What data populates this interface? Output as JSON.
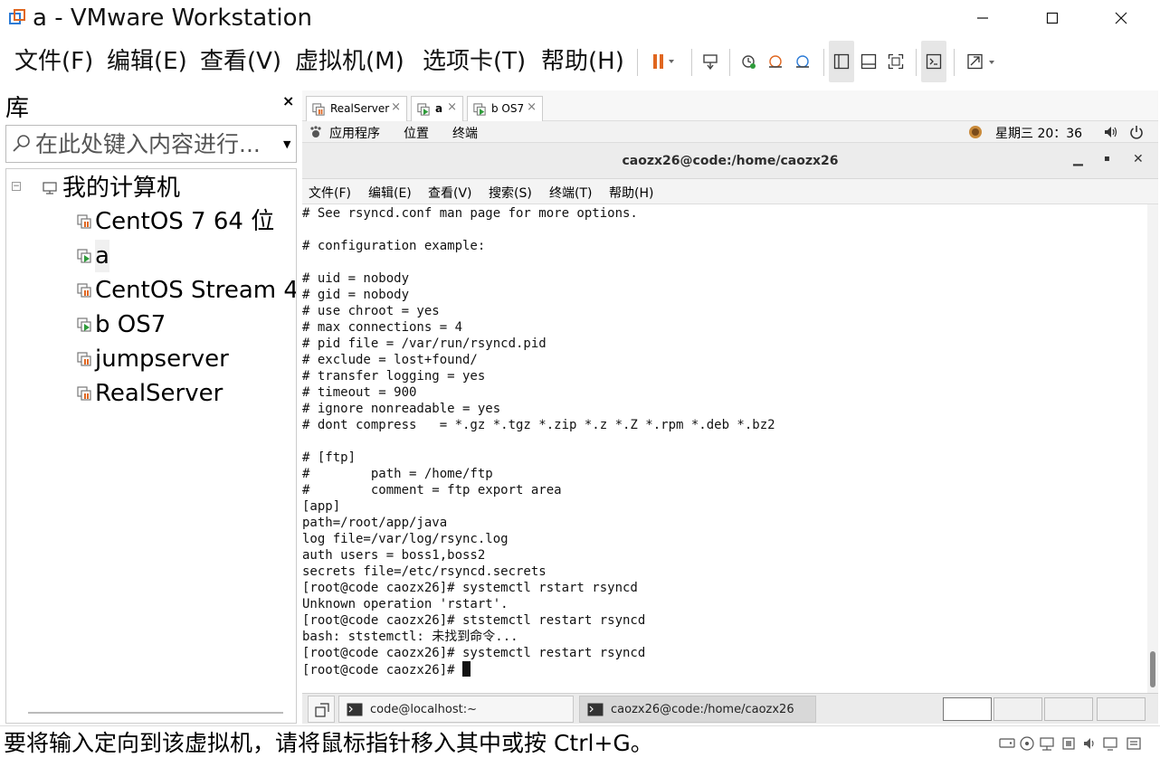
{
  "window": {
    "title": "a - VMware Workstation",
    "minimize": "—",
    "maximize": "☐",
    "close": "✕"
  },
  "menu": {
    "items": [
      "文件(F)",
      "编辑(E)",
      "查看(V)",
      "虚拟机(M)",
      "选项卡(T)",
      "帮助(H)"
    ]
  },
  "colors": {
    "pause": "#e0661f",
    "accent": "#2b7bd6",
    "vm_icon_orange": "#e0661f",
    "vm_running_green": "#2e9b3a"
  },
  "library": {
    "title": "库",
    "close": "×",
    "search_placeholder": "在此处键入内容进行...",
    "root_label": "我的计算机",
    "vms": [
      {
        "label": "CentOS 7 64 位",
        "state": "off"
      },
      {
        "label": "a",
        "state": "running"
      },
      {
        "label": "CentOS Stream 4",
        "state": "off"
      },
      {
        "label": "b OS7",
        "state": "running"
      },
      {
        "label": "jumpserver",
        "state": "off"
      },
      {
        "label": "RealServer",
        "state": "off"
      }
    ]
  },
  "tabs": [
    {
      "label": "RealServer",
      "close": "×",
      "active": false
    },
    {
      "label": "a",
      "close": "×",
      "active": true
    },
    {
      "label": "b OS7",
      "close": "×",
      "active": false
    }
  ],
  "guest": {
    "topbar": {
      "apps": "应用程序",
      "places": "位置",
      "terminal": "终端",
      "clock": "星期三 20：36"
    },
    "terminal_window": {
      "title": "caozx26@code:/home/caozx26",
      "min": "▁",
      "max": "▪",
      "close": "✕",
      "menu": [
        "文件(F)",
        "编辑(E)",
        "查看(V)",
        "搜索(S)",
        "终端(T)",
        "帮助(H)"
      ]
    },
    "lines": [
      "# See rsyncd.conf man page for more options.",
      "",
      "# configuration example:",
      "",
      "# uid = nobody",
      "# gid = nobody",
      "# use chroot = yes",
      "# max connections = 4",
      "# pid file = /var/run/rsyncd.pid",
      "# exclude = lost+found/",
      "# transfer logging = yes",
      "# timeout = 900",
      "# ignore nonreadable = yes",
      "# dont compress   = *.gz *.tgz *.zip *.z *.Z *.rpm *.deb *.bz2",
      "",
      "# [ftp]",
      "#        path = /home/ftp",
      "#        comment = ftp export area",
      "[app]",
      "path=/root/app/java",
      "log file=/var/log/rsync.log",
      "auth users = boss1,boss2",
      "secrets file=/etc/rsyncd.secrets",
      "[root@code caozx26]# systemctl rstart rsyncd",
      "Unknown operation 'rstart'.",
      "[root@code caozx26]# ststemctl restart rsyncd",
      "bash: ststemctl: 未找到命令...",
      "[root@code caozx26]# systemctl restart rsyncd"
    ],
    "prompt": "[root@code caozx26]# ",
    "taskbar": [
      {
        "label": "code@localhost:~",
        "active": false
      },
      {
        "label": "caozx26@code:/home/caozx26",
        "active": true
      }
    ]
  },
  "status": {
    "text": "要将输入定向到该虚拟机，请将鼠标指针移入其中或按 Ctrl+G。"
  }
}
